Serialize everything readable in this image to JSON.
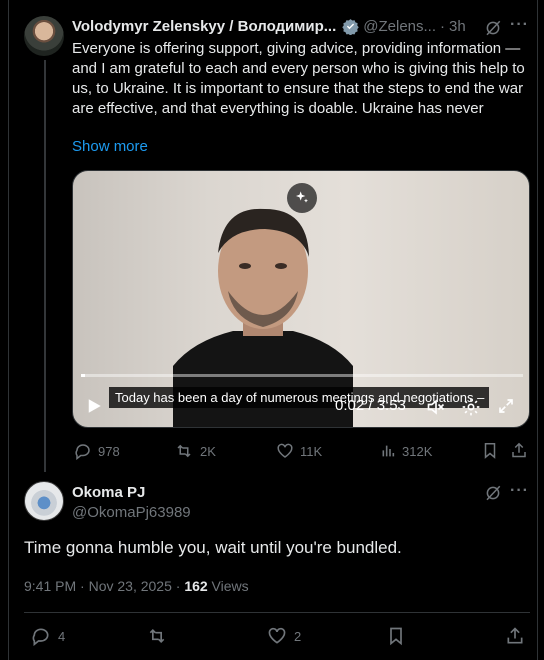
{
  "tweet": {
    "author_name": "Volodymyr Zelenskyy / Володимир...",
    "handle": "@Zelens...",
    "separator": "·",
    "age": "3h",
    "text": "Everyone is offering support, giving advice, providing information — and I am grateful to each and every person who is giving this help to us, to Ukraine. It is important to ensure that the steps to end the war are effective, and that everything is doable. Ukraine has never",
    "show_more": "Show more",
    "video": {
      "caption": "Today has been a day of numerous meetings and negotiations –",
      "time": "0:02 / 3:53",
      "progress_fraction": 0.01
    },
    "stats": {
      "replies": "978",
      "reposts": "2K",
      "likes": "11K",
      "views": "312K"
    }
  },
  "reply": {
    "author_name": "Okoma PJ",
    "handle": "@OkomaPj63989",
    "text": "Time gonna humble you, wait until you're bundled.",
    "timestamp": "9:41 PM · Nov 23, 2025 · ",
    "views_count": "162",
    "views_label": " Views",
    "stats": {
      "replies": "4",
      "reposts": "",
      "likes": "2"
    }
  },
  "colors": {
    "background": "#000000",
    "text": "#e7e9ea",
    "muted": "#71767b",
    "link": "#1d9bf0",
    "border": "#2f3336"
  },
  "icons": [
    "verified-badge-icon",
    "grok-icon",
    "more-icon",
    "sparkle-icon",
    "play-icon",
    "mute-icon",
    "settings-icon",
    "fullscreen-icon",
    "reply-icon",
    "repost-icon",
    "like-icon",
    "views-icon",
    "bookmark-icon",
    "share-icon"
  ]
}
